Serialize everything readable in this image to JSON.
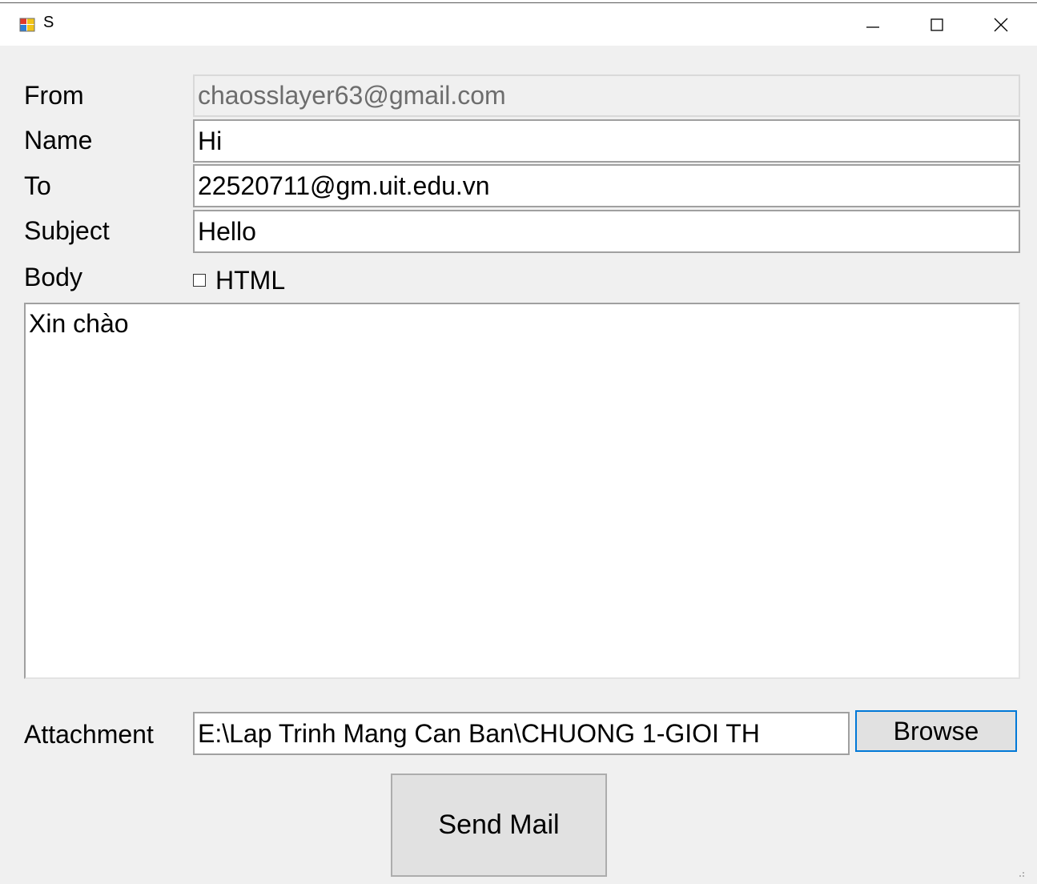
{
  "window": {
    "title": "S",
    "controls": {
      "minimize_icon": "minimize-icon",
      "maximize_icon": "maximize-icon",
      "close_icon": "close-icon"
    }
  },
  "form": {
    "from_label": "From",
    "from_value": "chaosslayer63@gmail.com",
    "name_label": "Name",
    "name_value": "Hi",
    "to_label": "To",
    "to_value": "22520711@gm.uit.edu.vn",
    "subject_label": "Subject",
    "subject_value": "Hello",
    "body_label": "Body",
    "html_checkbox_label": "HTML",
    "html_checked": false,
    "body_value": "Xin chào",
    "attachment_label": "Attachment",
    "attachment_value": "E:\\Lap Trinh Mang Can Ban\\CHUONG 1-GIOI TH",
    "browse_label": "Browse",
    "send_label": "Send Mail"
  },
  "colors": {
    "window_bg": "#f0f0f0",
    "focus_border": "#0078d7",
    "button_bg": "#e1e1e1"
  }
}
